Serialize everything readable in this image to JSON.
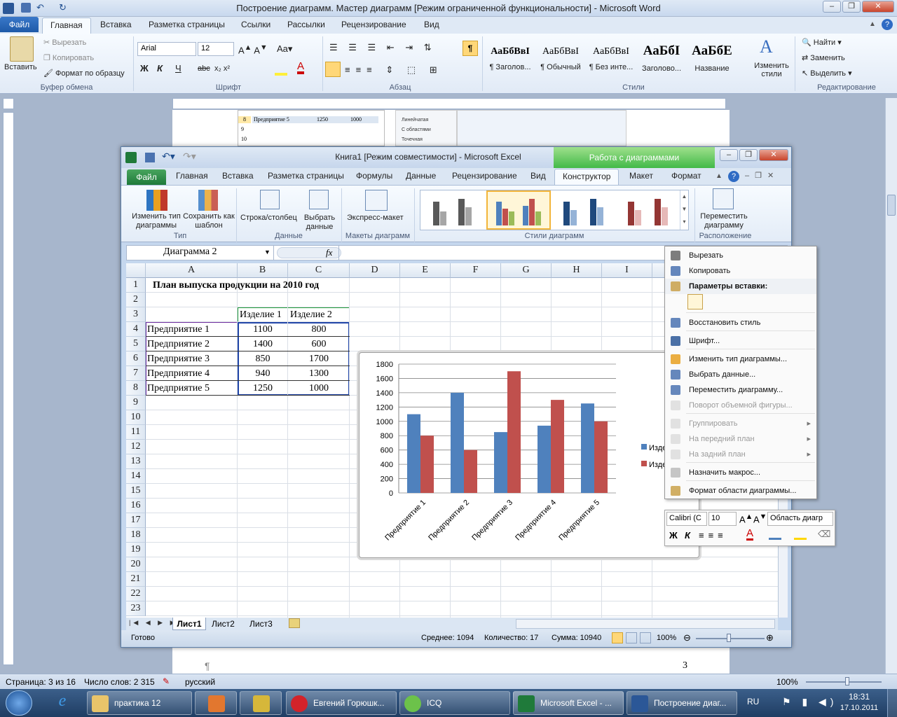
{
  "word": {
    "title": "Построение диаграмм. Мастер диаграмм [Режим ограниченной функциональности]  -  Microsoft Word",
    "file_tab": "Файл",
    "tabs": [
      "Главная",
      "Вставка",
      "Разметка страницы",
      "Ссылки",
      "Рассылки",
      "Рецензирование",
      "Вид"
    ],
    "clipboard": {
      "paste": "Вставить",
      "cut": "Вырезать",
      "copy": "Копировать",
      "format_painter": "Формат по образцу",
      "group": "Буфер обмена"
    },
    "font": {
      "name": "Arial",
      "size": "12",
      "group": "Шрифт",
      "bold": "Ж",
      "italic": "К",
      "underline": "Ч",
      "strike": "abc"
    },
    "paragraph": {
      "group": "Абзац"
    },
    "styles": {
      "group": "Стили",
      "items": [
        {
          "sample": "АаБбВвІ",
          "name": "¶ Заголов..."
        },
        {
          "sample": "АаБбВвІ",
          "name": "¶ Обычный"
        },
        {
          "sample": "АаБбВвІ",
          "name": "¶ Без инте..."
        },
        {
          "sample": "АаБбІ",
          "name": "Заголово..."
        },
        {
          "sample": "АаБбЕ",
          "name": "Название"
        }
      ],
      "change_styles": "Изменить стили"
    },
    "editing": {
      "group": "Редактирование",
      "find": "Найти",
      "replace": "Заменить",
      "select": "Выделить"
    },
    "page_number": "3",
    "status": {
      "page": "Страница: 3 из 16",
      "words": "Число слов: 2 315",
      "lang": "русский",
      "zoom": "100%"
    },
    "bg_preview": {
      "row8_num": "8",
      "row8_label": "Предприятие 5",
      "row8_b": "1250",
      "row8_c": "1000",
      "row9": "9",
      "row10": "10",
      "menu1": "Линейчатая",
      "menu2": "С областями",
      "menu3": "Точечная"
    }
  },
  "excel": {
    "title": "Книга1  [Режим совместимости]  -  Microsoft Excel",
    "context_tab": "Работа с диаграммами",
    "file_tab": "Файл",
    "tabs": [
      "Главная",
      "Вставка",
      "Разметка страницы",
      "Формулы",
      "Данные",
      "Рецензирование",
      "Вид",
      "Конструктор",
      "Макет",
      "Формат"
    ],
    "ribbon": {
      "change_type": "Изменить тип диаграммы",
      "save_template": "Сохранить как шаблон",
      "group_type": "Тип",
      "row_col": "Строка/столбец",
      "select_data": "Выбрать данные",
      "group_data": "Данные",
      "express_layout": "Экспресс-макет",
      "group_layouts": "Макеты диаграмм",
      "group_styles": "Стили диаграмм",
      "move_chart": "Переместить диаграмму",
      "group_location": "Расположение"
    },
    "name_box": "Диаграмма 2",
    "fx": "fx",
    "columns": [
      "A",
      "B",
      "C",
      "D",
      "E",
      "F",
      "G",
      "H",
      "I"
    ],
    "rows": [
      "1",
      "2",
      "3",
      "4",
      "5",
      "6",
      "7",
      "8",
      "9",
      "10",
      "11",
      "12",
      "13",
      "14",
      "15",
      "16",
      "17",
      "18",
      "19",
      "20",
      "21",
      "22",
      "23"
    ],
    "cells": {
      "title": "План выпуска продукции на 2010 год",
      "header": [
        "Изделие 1",
        "Изделие 2"
      ],
      "data": [
        [
          "Предприятие 1",
          "1100",
          "800"
        ],
        [
          "Предприятие 2",
          "1400",
          "600"
        ],
        [
          "Предприятие 3",
          "850",
          "1700"
        ],
        [
          "Предприятие 4",
          "940",
          "1300"
        ],
        [
          "Предприятие 5",
          "1250",
          "1000"
        ]
      ]
    },
    "sheets": [
      "Лист1",
      "Лист2",
      "Лист3"
    ],
    "status": {
      "ready": "Готово",
      "average": "Среднее: 1094",
      "count": "Количество: 17",
      "sum": "Сумма: 10940",
      "zoom": "100%"
    }
  },
  "chart_data": {
    "type": "bar",
    "categories": [
      "Предприятие 1",
      "Предприятие 2",
      "Предприятие 3",
      "Предприятие 4",
      "Предприятие 5"
    ],
    "series": [
      {
        "name": "Изде",
        "values": [
          1100,
          1400,
          850,
          940,
          1250
        ],
        "color": "#4f81bd"
      },
      {
        "name": "Изде",
        "values": [
          800,
          600,
          1700,
          1300,
          1000
        ],
        "color": "#c0504d"
      }
    ],
    "yticks": [
      "0",
      "200",
      "400",
      "600",
      "800",
      "1000",
      "1200",
      "1400",
      "1600",
      "1800"
    ],
    "ylim": [
      0,
      1800
    ],
    "grid": true,
    "legend": "right"
  },
  "context_menu": {
    "items": [
      {
        "label": "Вырезать",
        "icon": "scissors-icon",
        "enabled": true
      },
      {
        "label": "Копировать",
        "icon": "copy-icon",
        "enabled": true
      },
      {
        "label": "Параметры вставки:",
        "icon": "paste-icon",
        "enabled": true,
        "header": true
      },
      {
        "label": "Восстановить стиль",
        "icon": "reset-style-icon",
        "enabled": true
      },
      {
        "label": "Шрифт...",
        "icon": "font-icon",
        "enabled": true
      },
      {
        "label": "Изменить тип диаграммы...",
        "icon": "chart-type-icon",
        "enabled": true
      },
      {
        "label": "Выбрать данные...",
        "icon": "select-data-icon",
        "enabled": true
      },
      {
        "label": "Переместить диаграмму...",
        "icon": "move-chart-icon",
        "enabled": true
      },
      {
        "label": "Поворот объемной фигуры...",
        "icon": "rotate-icon",
        "enabled": false
      },
      {
        "label": "Группировать",
        "icon": "group-icon",
        "enabled": false
      },
      {
        "label": "На передний план",
        "icon": "bring-front-icon",
        "enabled": false
      },
      {
        "label": "На задний план",
        "icon": "send-back-icon",
        "enabled": false
      },
      {
        "label": "Назначить макрос...",
        "icon": "macro-icon",
        "enabled": true
      },
      {
        "label": "Формат области диаграммы...",
        "icon": "format-area-icon",
        "enabled": true
      }
    ]
  },
  "mini_toolbar": {
    "font": "Calibri (С",
    "size": "10",
    "element": "Область диагр",
    "bold": "Ж",
    "italic": "К"
  },
  "taskbar": {
    "items": [
      "практика 12",
      "",
      "",
      "Евгений Горюшк...",
      "ICQ",
      "Microsoft Excel - ...",
      "Построение диаг..."
    ],
    "lang": "RU",
    "time": "18:31",
    "date": "17.10.2011"
  }
}
